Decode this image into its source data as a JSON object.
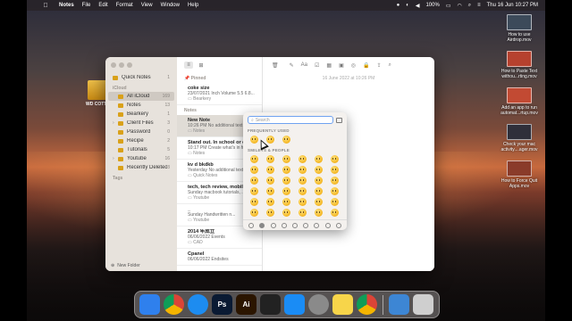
{
  "menubar": {
    "app_name": "Notes",
    "items": [
      "File",
      "Edit",
      "Format",
      "View",
      "Window",
      "Help"
    ],
    "battery": "100%",
    "datetime": "Thu 16 Jun  10:27 PM"
  },
  "desktop": {
    "drive_label": "WD COTTON",
    "files": [
      {
        "label": "How to use Airdrop.mov",
        "color": "#3c4a5a"
      },
      {
        "label": "How to Paste Text withou...rting.mov",
        "color": "#b6412e"
      },
      {
        "label": "Add an app to run automat...rtup.mov",
        "color": "#c24a33"
      },
      {
        "label": "Check your mac activity....ager.mov",
        "color": "#2f2f3a"
      },
      {
        "label": "How to Force Quit Apps.mov",
        "color": "#8a3b2a"
      }
    ]
  },
  "sidebar": {
    "quick_notes": {
      "label": "Quick Notes",
      "count": "1"
    },
    "section_icloud": "iCloud",
    "items": [
      {
        "label": "All iCloud",
        "count": "169",
        "active": true
      },
      {
        "label": "Notes",
        "count": "13"
      },
      {
        "label": "Bearkery",
        "count": "1"
      },
      {
        "label": "Client Files",
        "count": "3"
      },
      {
        "label": "Password",
        "count": "0"
      },
      {
        "label": "Recipe",
        "count": "2"
      },
      {
        "label": "Tutorials",
        "count": "5"
      },
      {
        "label": "Youtube",
        "count": "16"
      },
      {
        "label": "Recently Deleted",
        "count": "8"
      }
    ],
    "section_tags": "Tags",
    "new_folder": "New Folder"
  },
  "notelist": {
    "pinned_label": "Pinned",
    "pinned": [
      {
        "title": "coke size",
        "meta": "23/07/2021  Inch Volume 5.5 6.8...",
        "folder": "Bearkery"
      }
    ],
    "notes_label": "Notes",
    "notes": [
      {
        "title": "New Note",
        "meta": "10:26 PM  No additional text",
        "folder": "Notes",
        "selected": true
      },
      {
        "title": "Stand out. In school or out...",
        "meta": "10:17 PM  Create what's in front...",
        "folder": "Notes"
      },
      {
        "title": "kv d bkdkb",
        "meta": "Yesterday  No additional text",
        "folder": "Quick Notes"
      },
      {
        "title": "tech, tech review, mobile, ...",
        "meta": "Sunday  macbook tutorials, ...",
        "folder": "Youtube"
      },
      {
        "title": "_",
        "meta": "Sunday  Handwritten n...",
        "folder": "Youtube"
      },
      {
        "title": "2014 年成立",
        "meta": "06/06/2022  Events",
        "folder": "CAD"
      },
      {
        "title": "Cpanel",
        "meta": "06/06/2022  Endsites",
        "folder": ""
      }
    ]
  },
  "editor": {
    "date": "16 June 2022 at 10:26 PM",
    "toolbar_font": "Aa"
  },
  "emoji_picker": {
    "search_placeholder": "Search",
    "frequently_used": "FREQUENTLY USED",
    "smileys": "SMILEYS & PEOPLE",
    "frequent_count": 3,
    "smileys_count": 36
  },
  "dock": {
    "apps": [
      {
        "name": "finder-icon",
        "label": "",
        "color": "#2f80ed"
      },
      {
        "name": "chrome-icon",
        "label": "",
        "color": "#e8e8e8"
      },
      {
        "name": "safari-icon",
        "label": "",
        "color": "#1d8cf0"
      },
      {
        "name": "photoshop-icon",
        "label": "Ps",
        "color": "#0a1a33"
      },
      {
        "name": "illustrator-icon",
        "label": "Ai",
        "color": "#2b1500"
      },
      {
        "name": "final-cut-icon",
        "label": "",
        "color": "#222"
      },
      {
        "name": "app-store-icon",
        "label": "",
        "color": "#1a8cf5"
      },
      {
        "name": "system-preferences-icon",
        "label": "",
        "color": "#8a8a8a"
      },
      {
        "name": "notes-icon",
        "label": "",
        "color": "#f7d54a"
      },
      {
        "name": "chrome-canary-icon",
        "label": "",
        "color": "#e0c040"
      }
    ],
    "right": [
      {
        "name": "downloads-folder-icon",
        "label": "",
        "color": "#3d86d4"
      },
      {
        "name": "trash-icon",
        "label": "",
        "color": "#cfcfcf"
      }
    ]
  }
}
